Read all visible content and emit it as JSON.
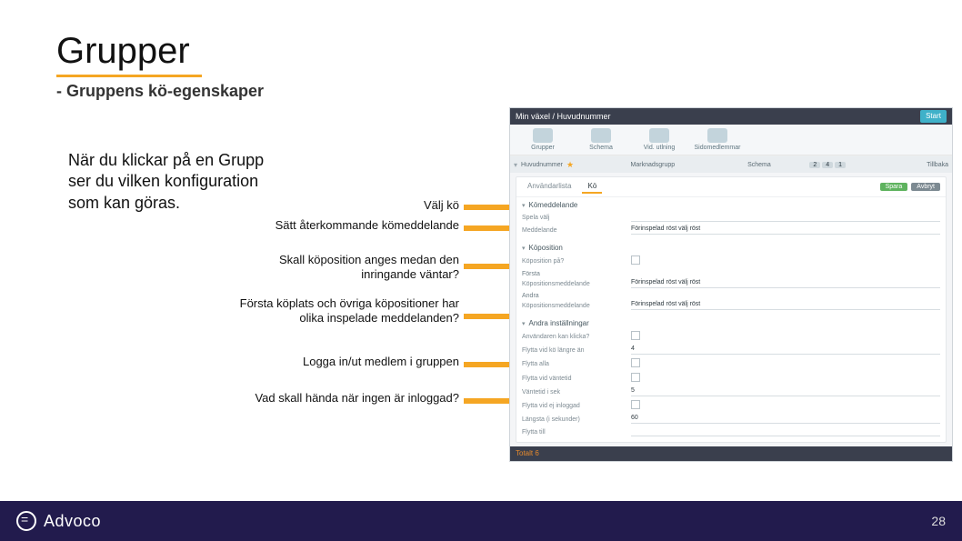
{
  "title": "Grupper",
  "subtitle": "- Gruppens kö-egenskaper",
  "body_paragraph": "När du klickar på en Grupp ser du vilken konfiguration som kan göras.",
  "annotations": {
    "a1": "Välj kö",
    "a2": "Sätt återkommande kömeddelande",
    "a3": "Skall köposition anges medan den inringande väntar?",
    "a4": "Första köplats och övriga köpositioner har olika inspelade meddelanden?",
    "a5": "Logga in/ut medlem i gruppen",
    "a6": "Vad skall hända när ingen är inloggad?"
  },
  "app": {
    "breadcrumb": "Min växel / Huvudnummer",
    "start_btn": "Start",
    "tools": [
      "Grupper",
      "Schema",
      "Vid. utlning",
      "Sidomedlemmar"
    ],
    "table": {
      "col_name": "Huvudnummer",
      "col_group": "Marknadsgrupp",
      "col_period": "Schema",
      "badge1": "2",
      "badge2": "4",
      "badge3": "1",
      "col_tb": "Tillbaka"
    },
    "tabs": {
      "t1": "Användarlista",
      "t2": "Kö"
    },
    "actions": {
      "save": "Spara",
      "cancel": "Avbryt"
    },
    "sections": {
      "s1_title": "Kömeddelande",
      "s1_r1_lbl": "Spela välj",
      "s1_r2_lbl": "Meddelande",
      "s1_r2_val": "Förinspelad röst välj röst",
      "s2_title": "Köposition",
      "s2_r1_lbl": "Köposition på?",
      "s2_sub1": "Första",
      "s2_r2_lbl": "Köpositionsmeddelande",
      "s2_r2_val": "Förinspelad röst välj röst",
      "s2_sub2": "Andra",
      "s2_r3_lbl": "Köpositionsmeddelande",
      "s2_r3_val": "Förinspelad röst välj röst",
      "s3_title": "Andra inställningar",
      "s3_r1_lbl": "Användaren kan klicka?",
      "s3_r2_lbl": "Flytta vid kö längre än",
      "s3_r2_val": "4",
      "s3_r3_lbl": "Flytta alla",
      "s3_r4_lbl": "Flytta vid väntetid",
      "s3_r5_lbl": "Väntetid i sek",
      "s3_r5_val": "5",
      "s3_r6_lbl": "Flytta vid ej inloggad",
      "s3_r7_lbl": "Längsta (i sekunder)",
      "s3_r7_val": "60",
      "s3_r8_lbl": "Flytta till"
    },
    "footer_total": "Totalt 6"
  },
  "footer": {
    "brand": "Advoco",
    "page": "28"
  }
}
